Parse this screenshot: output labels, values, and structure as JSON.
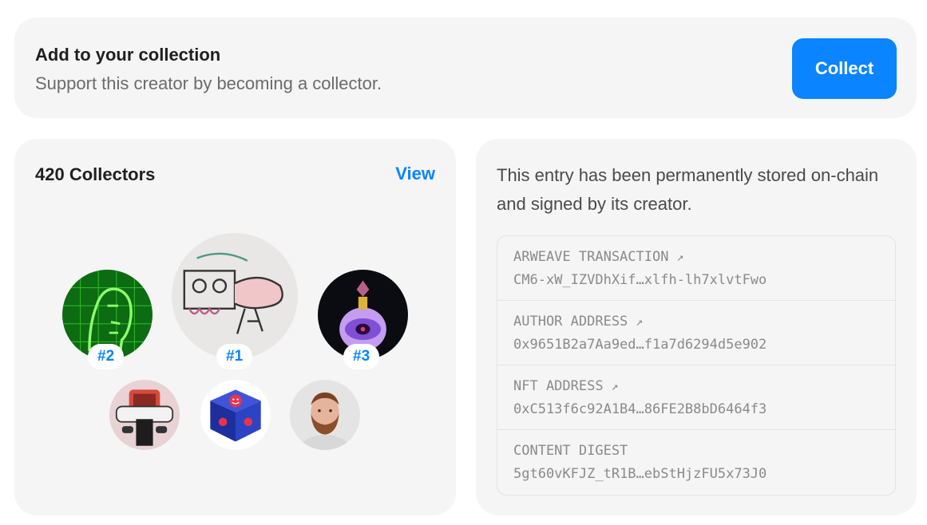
{
  "banner": {
    "title": "Add to your collection",
    "subtitle": "Support this creator by becoming a collector.",
    "collect_label": "Collect"
  },
  "collectors": {
    "title": "420 Collectors",
    "view_label": "View",
    "top": [
      {
        "rank": "#1",
        "icon": "sketch-drawing-avatar"
      },
      {
        "rank": "#2",
        "icon": "green-face-avatar"
      },
      {
        "rank": "#3",
        "icon": "potion-bottle-avatar"
      }
    ],
    "others": [
      {
        "icon": "robot-avatar"
      },
      {
        "icon": "smiley-cube-avatar"
      },
      {
        "icon": "bearded-man-avatar"
      }
    ]
  },
  "chain": {
    "description": "This entry has been permanently stored on-chain and signed by its creator.",
    "rows": [
      {
        "label": "ARWEAVE TRANSACTION",
        "value": "CM6-xW_IZVDhXif…xlfh-lh7xlvtFwo",
        "link": true
      },
      {
        "label": "AUTHOR ADDRESS",
        "value": "0x9651B2a7Aa9ed…f1a7d6294d5e902",
        "link": true
      },
      {
        "label": "NFT ADDRESS",
        "value": "0xC513f6c92A1B4…86FE2B8bD6464f3",
        "link": true
      },
      {
        "label": "CONTENT DIGEST",
        "value": "5gt60vKFJZ_tR1B…ebStHjzFU5x73J0",
        "link": false
      }
    ],
    "arrow_glyph": "↗"
  },
  "colors": {
    "accent": "#0a84ff",
    "card_bg": "#f5f5f5",
    "muted_text": "#8a8a8a"
  }
}
